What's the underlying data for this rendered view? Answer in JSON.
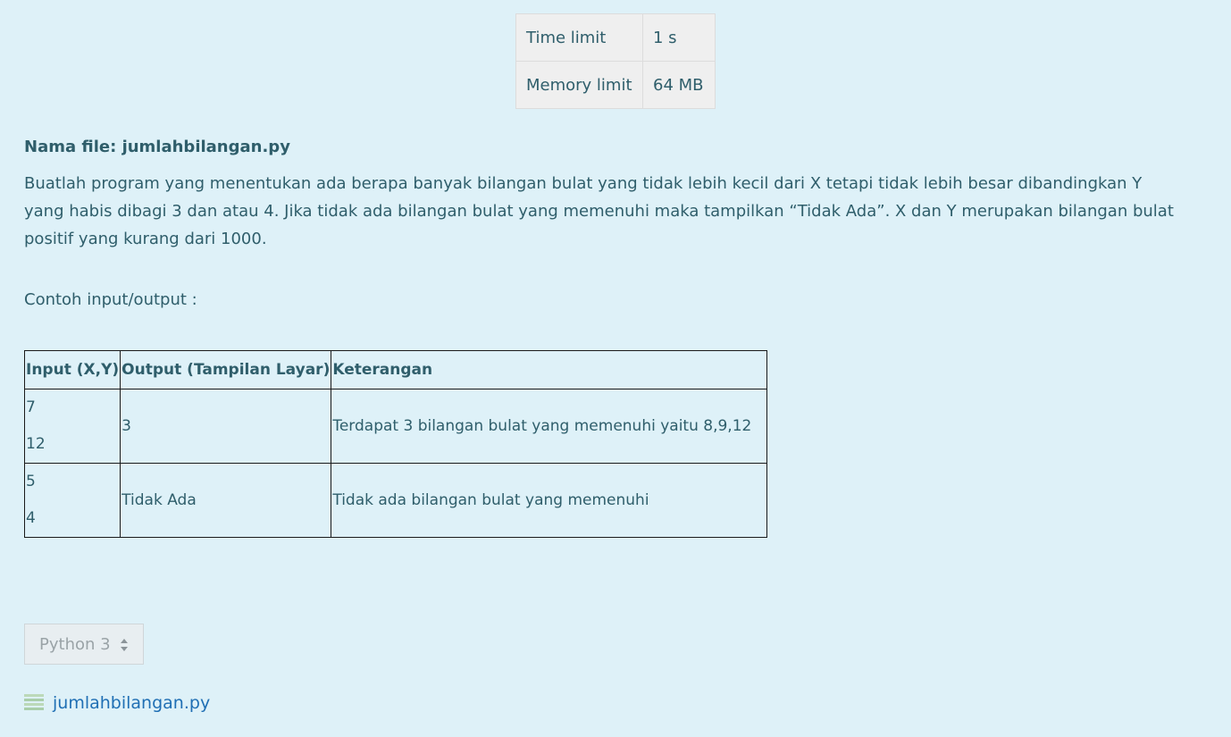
{
  "limits": {
    "time_label": "Time limit",
    "time_value": "1 s",
    "memory_label": "Memory limit",
    "memory_value": "64 MB"
  },
  "problem": {
    "filename": "Nama file: jumlahbilangan.py",
    "description": "Buatlah program yang menentukan ada berapa banyak bilangan bulat yang tidak lebih kecil dari X tetapi tidak lebih besar dibandingkan Y yang habis dibagi 3 dan atau 4. Jika tidak ada bilangan bulat yang memenuhi maka tampilkan “Tidak Ada”. X dan Y merupakan bilangan bulat positif yang kurang dari 1000.",
    "example_label": "Contoh input/output :"
  },
  "examples": {
    "headers": [
      "Input (X,Y)",
      "Output (Tampilan Layar)",
      "Keterangan"
    ],
    "rows": [
      {
        "x": "7",
        "y": "12",
        "output": "3",
        "note": "Terdapat 3 bilangan bulat yang memenuhi yaitu 8,9,12"
      },
      {
        "x": "5",
        "y": "4",
        "output": "Tidak Ada",
        "note": "Tidak ada bilangan bulat yang memenuhi"
      }
    ]
  },
  "language_select": {
    "selected": "Python 3"
  },
  "submission_file": {
    "name": "jumlahbilangan.py",
    "icon": "file-lines-icon"
  },
  "colors": {
    "background": "#def1f8",
    "text": "#2f5e6b",
    "link": "#1f6fb4"
  }
}
